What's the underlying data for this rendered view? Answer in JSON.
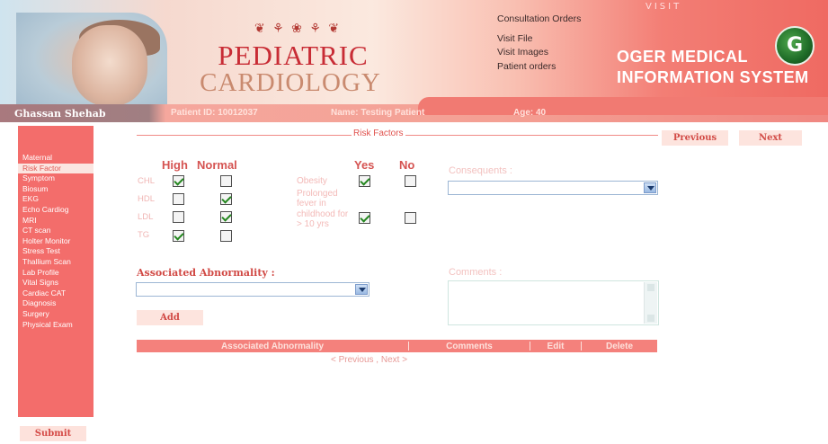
{
  "header": {
    "deco_text": "❦ ⚘ ❀ ⚘ ❦",
    "title_line1": "PEDIATRIC",
    "title_line2": "CARDIOLOGY",
    "links": [
      "Consultation Orders",
      "Visit File",
      "Visit Images",
      "Patient orders"
    ],
    "visit_label": "VISIT",
    "brand_line1": "OGER MEDICAL",
    "brand_line2": "INFORMATION SYSTEM",
    "logo_letter": "G"
  },
  "patient": {
    "name": "Ghassan Shehab",
    "id_text": "Patient ID: 10012037",
    "name_text": "Name: Testing Patient",
    "age_text": "Age: 40"
  },
  "sidebar": {
    "items": [
      "Maternal",
      "Risk Factor",
      "Symptom",
      "Biosum",
      "EKG",
      "Echo Cardiog",
      "MRI",
      "CT scan",
      "Holter Monitor",
      "Stress Test",
      "Thallium Scan",
      "Lab Profile",
      "Vital Signs",
      "Cardiac CAT",
      "Diagnosis",
      "Surgery",
      "Physical Exam"
    ],
    "active_index": 1,
    "submit_label": "Submit"
  },
  "risk": {
    "title": "Risk Factors",
    "previous_label": "Previous",
    "next_label": "Next",
    "col_high": "High",
    "col_normal": "Normal",
    "rows": [
      {
        "label": "CHL",
        "high": true,
        "normal": false
      },
      {
        "label": "HDL",
        "high": false,
        "normal": true
      },
      {
        "label": "LDL",
        "high": false,
        "normal": true
      },
      {
        "label": "TG",
        "high": true,
        "normal": false
      }
    ],
    "col_yes": "Yes",
    "col_no": "No",
    "factors": [
      {
        "label": "Obesity",
        "yes": true,
        "no": false
      },
      {
        "label": "Prolonged fever in childhood for > 10 yrs",
        "yes": true,
        "no": false
      }
    ],
    "consequents_label": "Consequents :",
    "consequents_value": ""
  },
  "assoc": {
    "label": "Associated Abnormality :",
    "value": "",
    "comments_label": "Comments :",
    "comments_value": "",
    "add_label": "Add"
  },
  "table": {
    "headers": [
      "Associated Abnormality",
      "Comments",
      "Edit",
      "Delete"
    ],
    "pager_prev": "< Previous",
    "pager_sep": " , ",
    "pager_next": "Next >"
  },
  "colors": {
    "accent": "#f36d6b",
    "brand_red": "#c82c35",
    "link": "#d14a45"
  }
}
